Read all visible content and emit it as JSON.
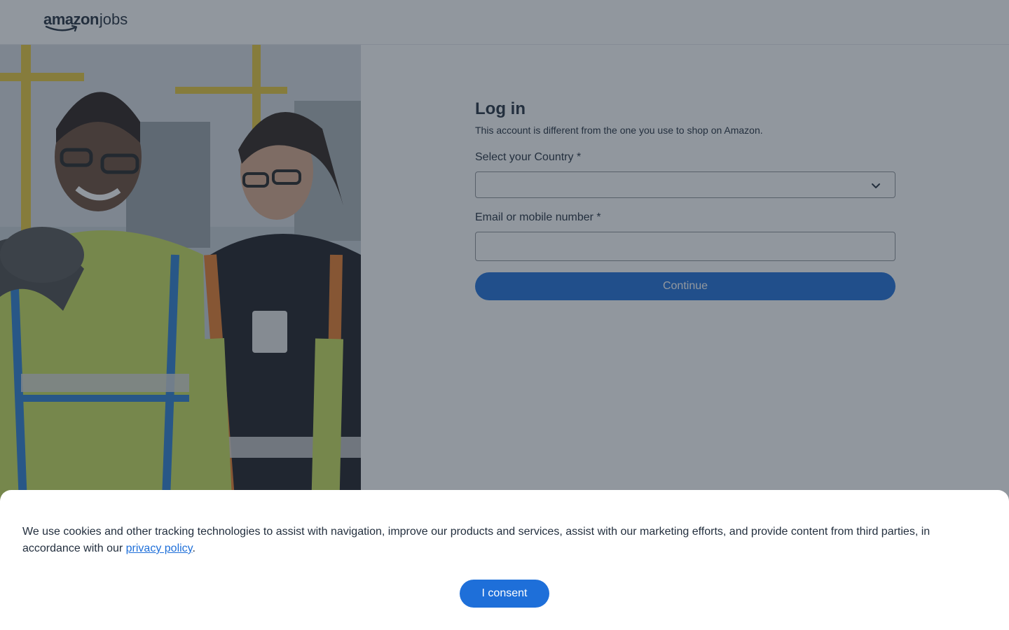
{
  "header": {
    "logo_amazon": "amazon",
    "logo_jobs": "jobs"
  },
  "login": {
    "title": "Log in",
    "subtitle": "This account is different from the one you use to shop on Amazon.",
    "country_label": "Select your Country *",
    "country_value": "",
    "email_label": "Email or mobile number *",
    "email_value": "",
    "continue_label": "Continue"
  },
  "cookie_banner": {
    "text_before_link": "We use cookies and other tracking technologies to assist with navigation, improve our products and services, assist with our marketing efforts, and provide content from third parties, in accordance with our ",
    "link_text": "privacy policy",
    "text_after_link": ".",
    "consent_label": "I consent"
  },
  "icons": {
    "select_arrow": "chevron-down-icon"
  },
  "colors": {
    "primary": "#1e6fd9",
    "text": "#232f3e",
    "overlay": "rgba(35,47,62,0.5)"
  }
}
